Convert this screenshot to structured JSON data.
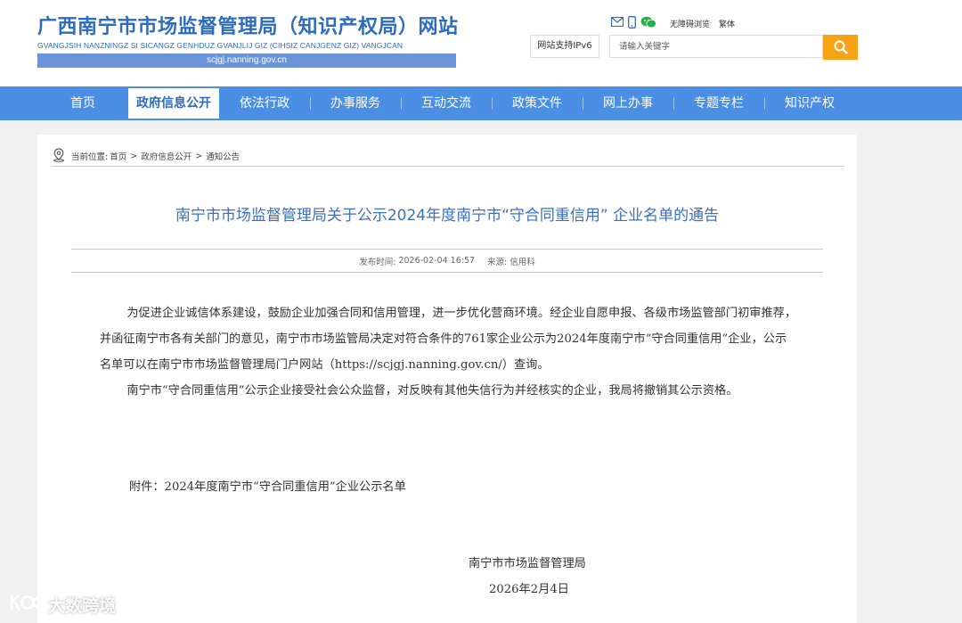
{
  "header": {
    "title": "广西南宁市市场监督管理局（知识产权局）网站",
    "pinyin": "GVANGJSIH NANZNINGZ SI SICANGZ GENHDUZ GVANJLIJ GIZ (CIHSIZ CANJGENZ GIZ) VANGJCAN",
    "url": "scjgj.nanning.gov.cn",
    "accessibility": "无障碍浏览",
    "traditional": "繁体",
    "ipv6": "网站支持IPv6",
    "search_placeholder": "请输入关键字"
  },
  "nav": {
    "items": [
      "首页",
      "政府信息公开",
      "依法行政",
      "办事服务",
      "互动交流",
      "政策文件",
      "网上办事",
      "专题专栏",
      "知识产权"
    ],
    "active": "政府信息公开"
  },
  "breadcrumb": {
    "prefix": "当前位置:",
    "items": [
      "首页",
      "政府信息公开",
      "通知公告"
    ],
    "separator": ">"
  },
  "article": {
    "title": "南宁市市场监督管理局关于公示2024年度南宁市“守合同重信用” 企业名单的通告",
    "publish_label": "发布时间:",
    "publish_time": "2026-02-04 16:57",
    "source_label": "来源:",
    "source": "信用科",
    "paragraphs": [
      "为促进企业诚信体系建设，鼓励企业加强合同和信用管理，进一步优化营商环境。经企业自愿申报、各级市场监管部门初审推荐，并函征南宁市各有关部门的意见，南宁市市场监管局决定对符合条件的761家企业公示为2024年度南宁市“守合同重信用”企业，公示名单可以在南宁市市场监督管理局门户网站（https://scjgj.nanning.gov.cn/）查询。",
      "南宁市“守合同重信用”公示企业接受社会公众监督，对反映有其他失信行为并经核实的企业，我局将撤销其公示资格。"
    ],
    "attachment": "附件：2024年度南宁市“守合同重信用”企业公示名单",
    "signature_org": "南宁市市场监督管理局",
    "signature_date": "2026年2月4日"
  },
  "watermark": "大数跨境",
  "colors": {
    "brand_blue": "#2d6bbd",
    "nav_blue": "#4a8fe4",
    "search_orange": "#f7a318"
  }
}
